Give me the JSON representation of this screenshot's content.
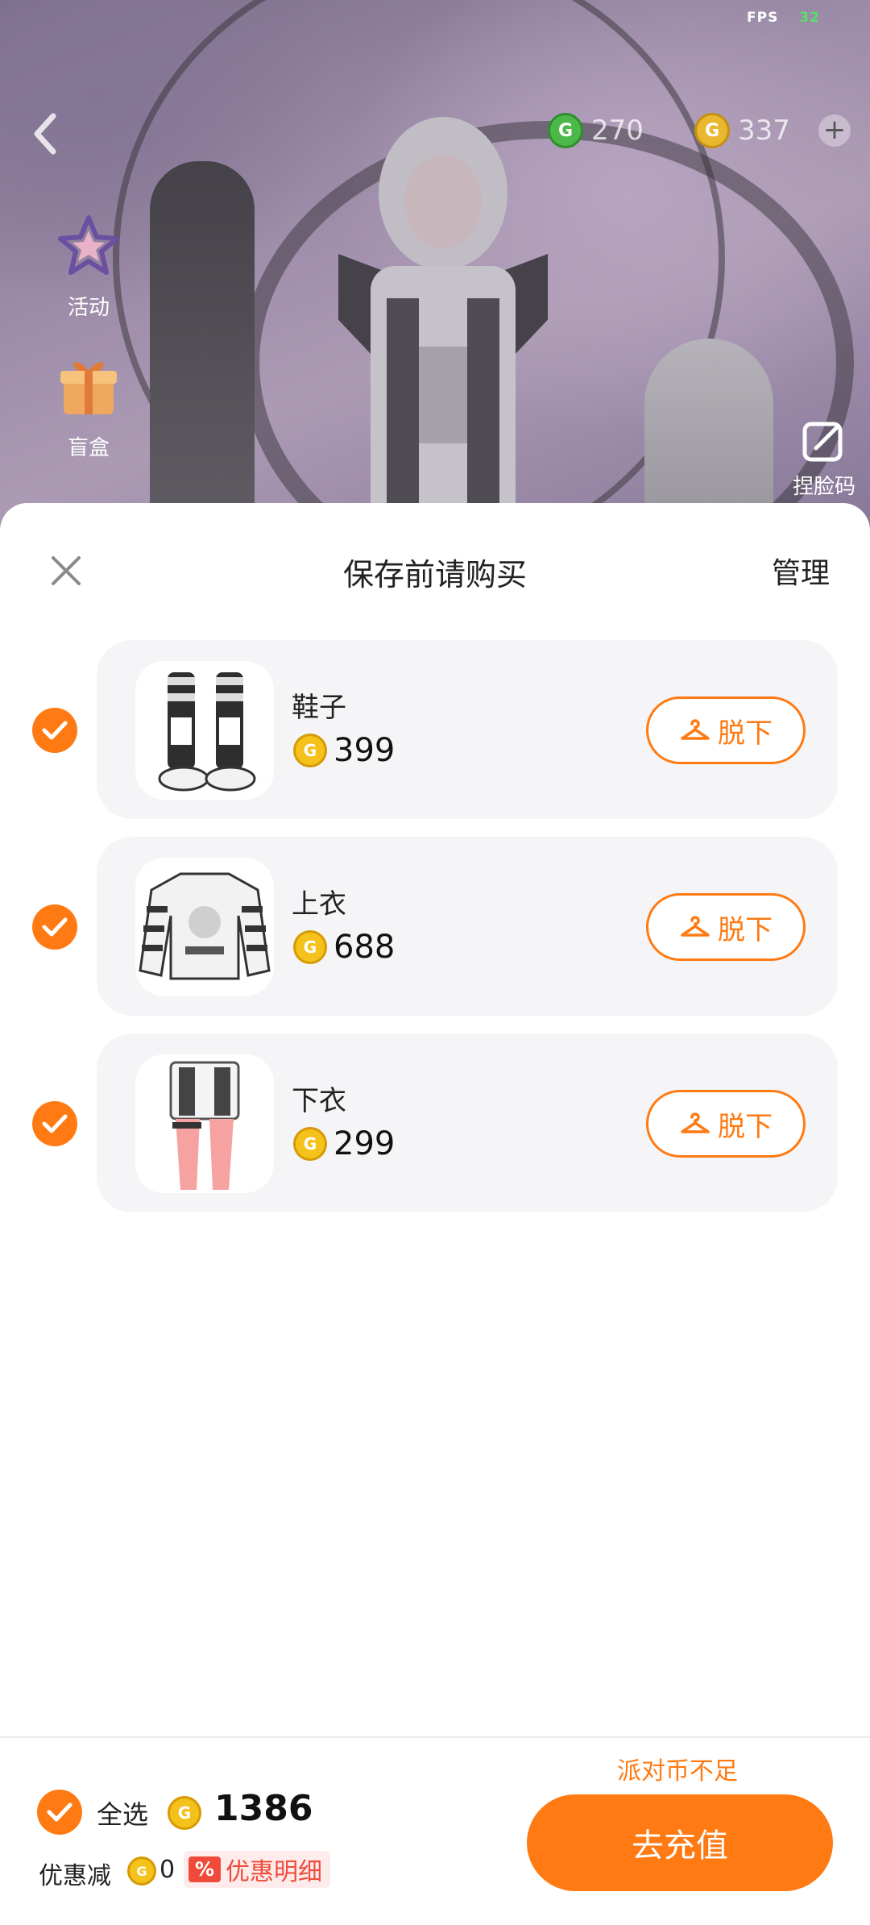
{
  "status": {
    "fps_label": "FPS",
    "fps_value": "32"
  },
  "header": {
    "green_currency": "270",
    "gold_currency": "337",
    "add_icon": "plus-icon"
  },
  "side_menu": [
    {
      "label": "活动",
      "icon": "star-icon"
    },
    {
      "label": "盲盒",
      "icon": "gift-box-icon"
    }
  ],
  "faceid": {
    "label": "捏脸码",
    "icon": "edit-icon"
  },
  "sheet": {
    "title": "保存前请购买",
    "manage": "管理",
    "items": [
      {
        "name": "鞋子",
        "price": "399",
        "button": "脱下",
        "checked": true
      },
      {
        "name": "上衣",
        "price": "688",
        "button": "脱下",
        "checked": true
      },
      {
        "name": "下衣",
        "price": "299",
        "button": "脱下",
        "checked": true
      }
    ]
  },
  "footer": {
    "select_all": "全选",
    "total": "1386",
    "discount_label": "优惠减",
    "discount_value": "0",
    "discount_tag": "%",
    "discount_detail": "优惠明细",
    "insufficient": "派对币不足",
    "recharge": "去充值"
  },
  "colors": {
    "accent": "#ff7a12",
    "coin": "#f4c21b",
    "card": "#f5f5f7",
    "discount": "#f04a3a"
  }
}
